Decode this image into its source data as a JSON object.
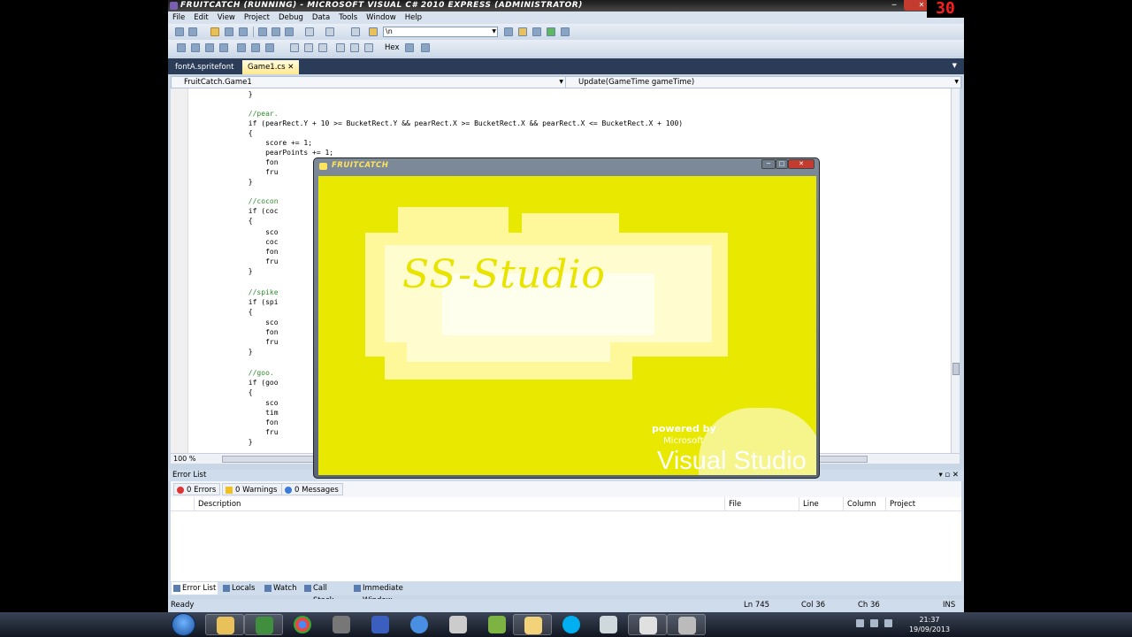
{
  "window": {
    "title": "FRUITCATCH (RUNNING) - MICROSOFT VISUAL C# 2010 EXPRESS (ADMINISTRATOR)",
    "minimize": "─",
    "close": "✕"
  },
  "menu": [
    "File",
    "Edit",
    "View",
    "Project",
    "Debug",
    "Data",
    "Tools",
    "Window",
    "Help"
  ],
  "toolbar": {
    "find_value": "\\n",
    "hex_label": "Hex"
  },
  "tabs": [
    {
      "label": "fontA.spritefont"
    },
    {
      "label": "Game1.cs"
    }
  ],
  "tab_close": "✕",
  "navbar": {
    "type_dropdown": "FruitCatch.Game1",
    "member_dropdown": "Update(GameTime gameTime)"
  },
  "code_lines": [
    "            }",
    "",
    "            //pear.",
    "            if (pearRect.Y + 10 >= BucketRect.Y && pearRect.X >= BucketRect.X && pearRect.X <= BucketRect.X + 100)",
    "            {",
    "                score += 1;",
    "                pearPoints += 1;",
    "                fon",
    "                fru",
    "            }",
    "",
    "            //cocon",
    "            if (coc",
    "            {",
    "                sco",
    "                coc",
    "                fon",
    "                fru",
    "            }",
    "",
    "            //spike",
    "            if (spi",
    "            {",
    "                sco",
    "                fon",
    "                fru",
    "            }",
    "",
    "            //goo.",
    "            if (goo",
    "            {",
    "                sco",
    "                tim",
    "                fon",
    "                fru",
    "            }"
  ],
  "zoom": "100 %",
  "error_list": {
    "title": "Error List",
    "errors": "0 Errors",
    "warnings": "0 Warnings",
    "messages": "0 Messages",
    "columns": [
      "Description",
      "File",
      "Line",
      "Column",
      "Project"
    ]
  },
  "bottom_tabs": [
    "Error List",
    "Locals",
    "Watch",
    "Call Stack",
    "Immediate Window"
  ],
  "status": {
    "ready": "Ready",
    "ln": "Ln 745",
    "col": "Col 36",
    "ch": "Ch 36",
    "mode": "INS"
  },
  "game": {
    "title": "FRUITCATCH",
    "brand": "SS-Studio",
    "powered_by": "powered by",
    "microsoft": "Microsoft",
    "visual_studio": "Visual Studio"
  },
  "taskbar": {
    "time": "21:37",
    "date": "19/09/2013",
    "apps": [
      "explorer-icon",
      "csharp-express-icon",
      "chrome-icon",
      "game-icon",
      "visual-studio-icon",
      "itunes-icon",
      "unity-icon",
      "android-icon",
      "folder-icon",
      "skype-icon",
      "notepad-icon",
      "installer-icon",
      "gamepad-icon"
    ]
  },
  "fps_counter": "30",
  "colors": {
    "game_background": "#e8e800",
    "fps_text": "#ff1e1e",
    "vs_frame": "#c9d6e5"
  }
}
